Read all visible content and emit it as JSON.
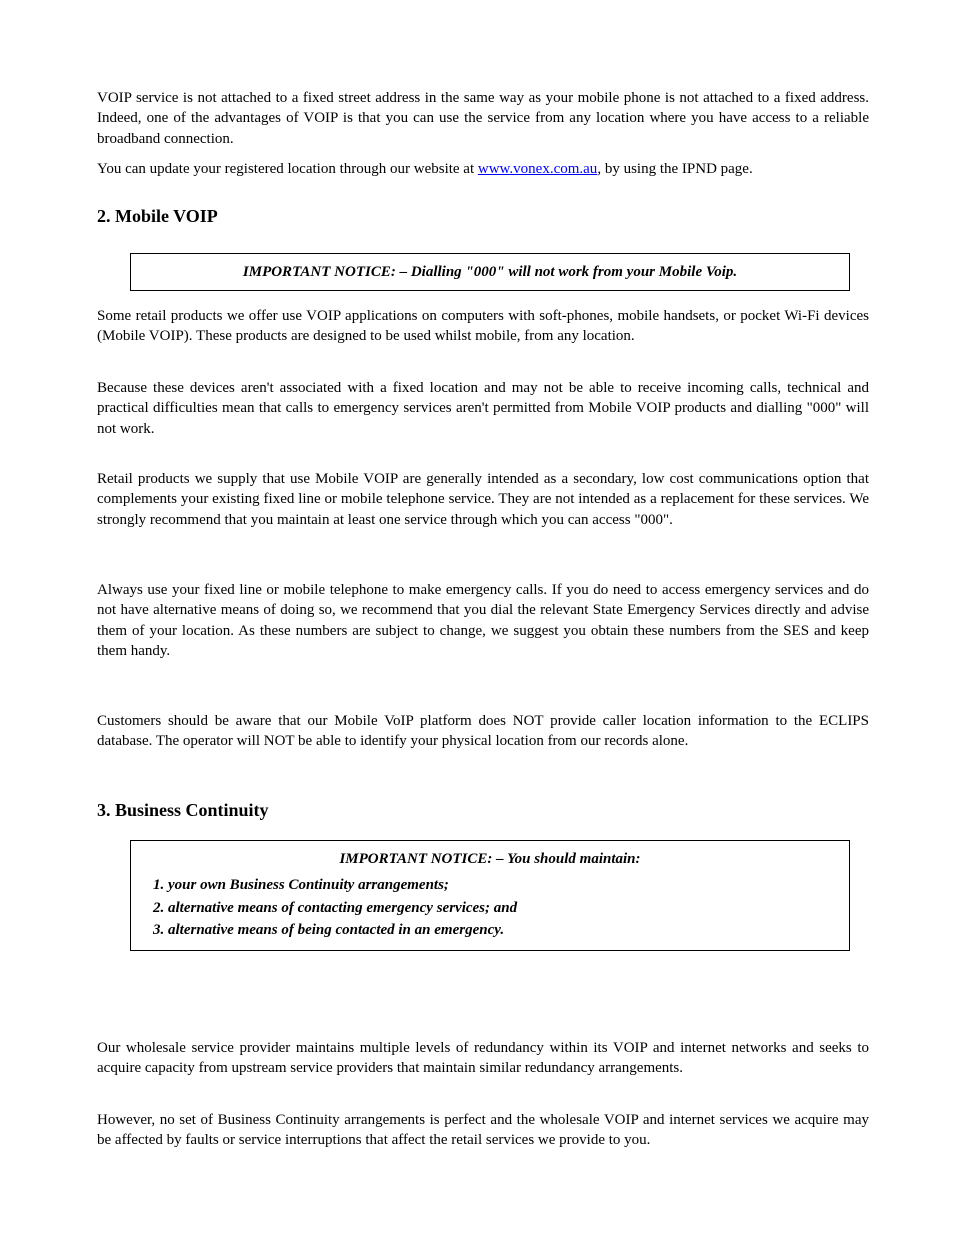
{
  "para1": "VOIP service is not attached to a fixed street address in the same way as your mobile phone is not attached to a fixed address.  Indeed, one of the advantages of VOIP is that you can use the service from any location where you have access to a reliable broadband connection.",
  "para2_before": "You can update your registered location through our website at ",
  "link_text": "www.vonex.com.au",
  "para2_after": ", by using the IPND page.",
  "heading1": "2.  Mobile VOIP",
  "callout1": "IMPORTANT NOTICE: – Dialling \"000\" will not work from your Mobile Voip.",
  "para3": "Some retail products we offer use VOIP applications on computers with soft-phones, mobile handsets, or pocket Wi-Fi devices (Mobile VOIP).  These products are designed to be used whilst mobile, from any location.",
  "para4": "Because these devices aren't associated with a fixed location and may not be able to receive incoming calls, technical and practical difficulties mean that calls to emergency services aren't permitted from Mobile VOIP products and dialling \"000\" will not work.",
  "para5": "Retail products we supply that use Mobile VOIP are generally intended as a secondary, low cost communications option that complements your existing fixed line or mobile telephone service. They are not intended as a replacement for these services.  We strongly recommend that you maintain at least one service through which you can access \"000\".",
  "para6": "Always use your fixed line or mobile telephone to make emergency calls.  If you do need to access emergency services and do not have alternative means of doing so, we recommend that you dial the relevant State Emergency Services directly and advise them of your location.  As these numbers are subject to change, we suggest you obtain these numbers from the SES and keep them handy.",
  "para7": "Customers should be aware that our Mobile VoIP platform does NOT provide caller location information to the ECLIPS database. The operator will NOT be able to identify your physical location from our records alone.",
  "heading2": "3.  Business Continuity",
  "callout2_head": "IMPORTANT NOTICE: – You should maintain:",
  "callout2_items": [
    "your own Business Continuity arrangements;",
    "alternative means of contacting emergency services; and",
    "alternative means of being contacted in an emergency."
  ],
  "para8": "Our wholesale service provider maintains multiple levels of redundancy within its VOIP and internet networks and seeks to acquire capacity from upstream service providers that maintain similar redundancy arrangements.",
  "para9": "However, no set of Business Continuity arrangements is perfect and the wholesale VOIP and internet services we acquire may be affected by faults or service interruptions that affect the retail services we provide to you."
}
